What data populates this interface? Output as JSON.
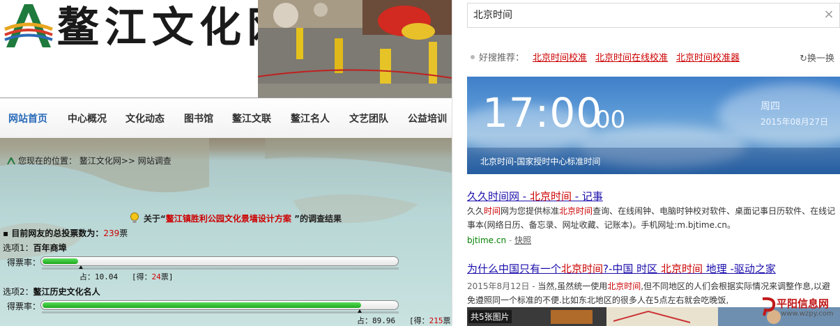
{
  "left": {
    "site_title": "鳌江文化网",
    "nav": [
      "网站首页",
      "中心概况",
      "文化动态",
      "图书馆",
      "鳌江文联",
      "鳌江名人",
      "文艺团队",
      "公益培训"
    ],
    "breadcrumb": "您现在的位置： 鳌江文化网>> 网站调查",
    "survey": {
      "prefix": "关于“",
      "name": "鳌江镇胜利公园文化景墙设计方案",
      "suffix": " ”的调查结果",
      "total_label": "目前网友的总投票数为：",
      "total_votes": "239",
      "total_unit": "票",
      "rate_label": "得票率：",
      "options": [
        {
          "label": "选项1：",
          "name": "百年商埠",
          "percent_text": "占：10.04",
          "votes_prefix": "[得：",
          "votes": "24",
          "votes_suffix": "票]",
          "share": 0.1004
        },
        {
          "label": "选项2：",
          "name": "鳌江历史文化名人",
          "percent_text": "占：89.96",
          "votes_prefix": "[得：",
          "votes": "215",
          "votes_suffix": "票]",
          "share": 0.8996
        }
      ]
    }
  },
  "right": {
    "search": {
      "value": "北京时间"
    },
    "recommend": {
      "label": "好搜推荐：",
      "links": [
        "北京时间校准",
        "北京时间在线校准",
        "北京时间校准器"
      ],
      "refresh": "换一换"
    },
    "clock": {
      "time": "17:00",
      "seconds": "00",
      "weekday": "周四",
      "date": "2015年08月27日",
      "caption": "北京时间-国家授时中心标准时间"
    },
    "results": [
      {
        "title_a": "久久时间网 - ",
        "title_hl": "北京时间",
        "title_b": " - 记事",
        "desc_1": "久久",
        "desc_hl1": "时间",
        "desc_2": "网为您提供标准",
        "desc_hl2": "北京时间",
        "desc_3": "查询、在线闹钟、电脑时钟校对软件、桌面记事日历软件、在线记事本(网络日历、备忘录、网址收藏、记账本)。手机网址:m.bjtime.cn。",
        "url": "bjtime.cn",
        "sep": " - ",
        "snapshot": "快照"
      },
      {
        "title_a": "为什么中国只有一个",
        "title_hl": "北京时间",
        "title_b": "?-中国 时区 ",
        "title_hl2": "北京时间",
        "title_c": " 地理 -驱动之家",
        "date": "2015年8月12日 - ",
        "desc_1": "当然,虽然统一使用",
        "desc_hl1": "北京时间",
        "desc_2": ",但不同地区的人们会根据实际情况来调整作息,以避免遵照同一个标准的不便.比如东北地区的很多人在5点左右就会吃晚饭,"
      }
    ],
    "image_strip": {
      "count": "共5张图片"
    }
  },
  "watermark": {
    "name": "平阳信息网",
    "url": "www.wzpy.com"
  },
  "colors": {
    "link": "#1a0dab",
    "highlight": "#c00000",
    "nav_active": "#2a6ab8",
    "bar": "#1da81d"
  }
}
